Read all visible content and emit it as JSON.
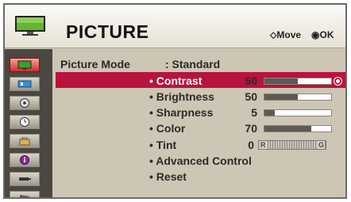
{
  "header": {
    "title": "PICTURE",
    "move_hint": "Move",
    "ok_hint": "OK",
    "move_icon": "four-way-arrows-icon",
    "ok_icon": "ok-button-icon"
  },
  "sidebar": {
    "items": [
      {
        "icon": "picture-icon",
        "active": true
      },
      {
        "icon": "audio-icon",
        "active": false
      },
      {
        "icon": "disc-icon",
        "active": false
      },
      {
        "icon": "clock-icon",
        "active": false
      },
      {
        "icon": "lock-icon",
        "active": false
      },
      {
        "icon": "info-icon",
        "active": false
      },
      {
        "icon": "input-icon",
        "active": false
      },
      {
        "icon": "clapper-icon",
        "active": false
      }
    ]
  },
  "menu": {
    "picture_mode_label": "Picture Mode",
    "picture_mode_value": ": Standard",
    "contrast": {
      "label": "• Contrast",
      "value": "50",
      "level": 0.5
    },
    "brightness": {
      "label": "• Brightness",
      "value": "50",
      "level": 0.5
    },
    "sharpness": {
      "label": "• Sharpness",
      "value": "5",
      "level": 0.16
    },
    "color": {
      "label": "• Color",
      "value": "70",
      "level": 0.7
    },
    "tint": {
      "label": "• Tint",
      "value": "0",
      "left": "R",
      "right": "G"
    },
    "advanced": "• Advanced Control",
    "reset": "• Reset"
  },
  "colors": {
    "selection": "#b8133d",
    "sidebar_bg": "#4b4741",
    "panel_bg": "#cdc6b4"
  }
}
